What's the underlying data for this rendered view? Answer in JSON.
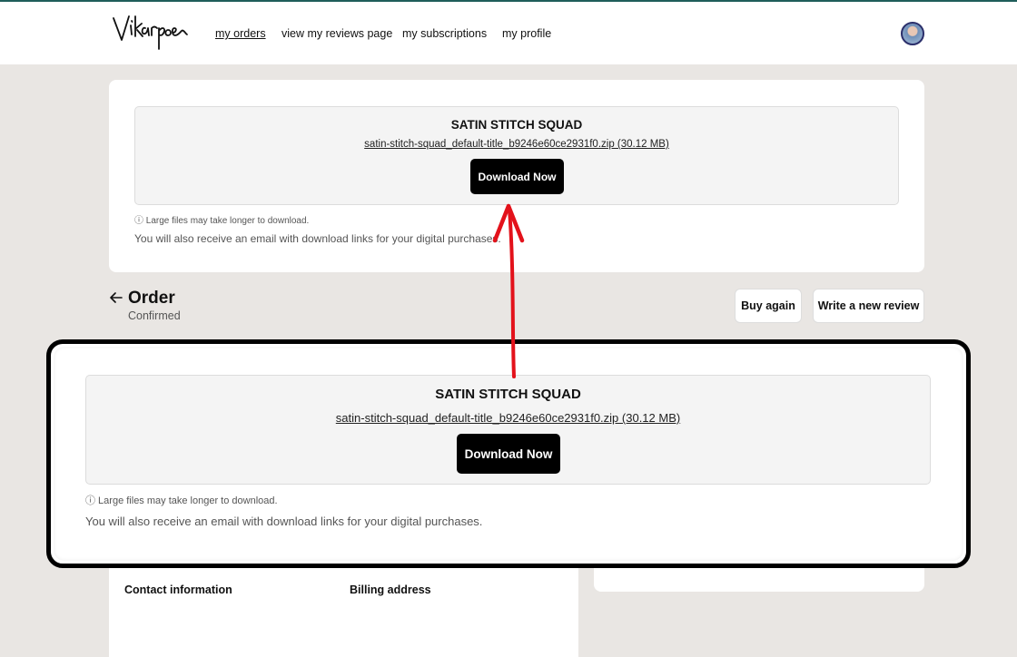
{
  "header": {
    "logo_text": "Vikarpore",
    "nav": [
      "my orders",
      "view my reviews page",
      "my subscriptions",
      "my profile"
    ]
  },
  "download_card": {
    "product_title": "SATIN STITCH SQUAD",
    "file_link": "satin-stitch-squad_default-title_b9246e60ce2931f0.zip (30.12 MB)",
    "button": "Download Now",
    "large_file_note": "ⓘ Large files may take longer to download.",
    "email_note": "You will also receive an email with download links for your digital purchases."
  },
  "order": {
    "title": "Order",
    "status": "Confirmed",
    "buy_again": "Buy again",
    "write_review": "Write a new review"
  },
  "details": {
    "contact": "Contact information",
    "billing": "Billing address"
  },
  "colors": {
    "accent_line": "#1f5d5a",
    "annotation_arrow": "#e3121b",
    "button_bg": "#000000"
  }
}
